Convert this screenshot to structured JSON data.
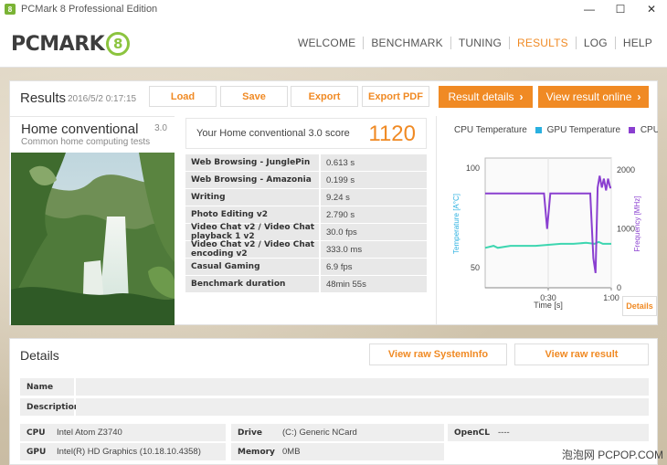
{
  "window": {
    "title": "PCMark 8 Professional Edition",
    "icon_glyph": "8",
    "controls": [
      "—",
      "☐",
      "✕"
    ]
  },
  "logo": {
    "text": "PCMARK",
    "badge": "8"
  },
  "nav": {
    "items": [
      "WELCOME",
      "BENCHMARK",
      "TUNING",
      "RESULTS",
      "LOG",
      "HELP"
    ],
    "active": "RESULTS"
  },
  "results": {
    "title": "Results",
    "date": "2016/5/2 0:17:15",
    "buttons": {
      "load": "Load",
      "save": "Save",
      "export": "Export",
      "export_pdf": "Export PDF",
      "result_details": "Result details",
      "view_online": "View result online"
    },
    "test": {
      "name": "Home conventional",
      "version": "3.0",
      "description": "Common home computing tests"
    },
    "score": {
      "label": "Your Home conventional 3.0 score",
      "value": "1120"
    },
    "rows": [
      {
        "label": "Web Browsing - JunglePin",
        "value": "0.613 s"
      },
      {
        "label": "Web Browsing - Amazonia",
        "value": "0.199 s"
      },
      {
        "label": "Writing",
        "value": "9.24 s"
      },
      {
        "label": "Photo Editing v2",
        "value": "2.790 s"
      },
      {
        "label": "Video Chat v2 / Video Chat playback 1 v2",
        "value": "30.0 fps"
      },
      {
        "label": "Video Chat v2 / Video Chat encoding v2",
        "value": "333.0 ms"
      },
      {
        "label": "Casual Gaming",
        "value": "6.9 fps"
      },
      {
        "label": "Benchmark duration",
        "value": "48min 55s"
      }
    ]
  },
  "chart_data": {
    "type": "line",
    "legend": [
      {
        "name": "CPU Temperature",
        "color": "#ffffff"
      },
      {
        "name": "GPU Temperature",
        "color": "#2ab0e0"
      },
      {
        "name": "CPU Clock Frequency",
        "color": "#8a3fd0"
      }
    ],
    "ylabel_left": "Temperature [A°C]",
    "ylabel_right": "Frequency [MHz]",
    "xlabel": "Time [s]",
    "y_left_ticks": [
      "100",
      "50"
    ],
    "y_right_ticks": [
      "2000",
      "1000",
      "0"
    ],
    "x_ticks": [
      "0:30",
      "1:00"
    ],
    "y_left_range": [
      40,
      105
    ],
    "y_right_range": [
      0,
      2200
    ],
    "x_range": [
      0,
      60
    ],
    "series": [
      {
        "name": "GPU Temperature",
        "axis": "left",
        "color": "#3dd6b0",
        "points": [
          [
            0,
            60
          ],
          [
            4,
            61
          ],
          [
            6,
            60
          ],
          [
            12,
            61
          ],
          [
            18,
            61
          ],
          [
            24,
            61
          ],
          [
            30,
            61.5
          ],
          [
            36,
            62
          ],
          [
            42,
            62
          ],
          [
            48,
            62.5
          ],
          [
            52,
            62
          ],
          [
            54,
            63
          ],
          [
            56,
            62
          ],
          [
            58,
            62
          ],
          [
            60,
            62
          ]
        ]
      },
      {
        "name": "CPU Clock Frequency",
        "axis": "right",
        "color": "#8a3fd0",
        "points": [
          [
            0,
            1600
          ],
          [
            27,
            1600
          ],
          [
            28,
            1600
          ],
          [
            29.5,
            1000
          ],
          [
            31,
            1600
          ],
          [
            50,
            1600
          ],
          [
            51.5,
            500
          ],
          [
            52.5,
            250
          ],
          [
            53.5,
            1700
          ],
          [
            54.5,
            1900
          ],
          [
            55.5,
            1700
          ],
          [
            56.5,
            1850
          ],
          [
            57.5,
            1650
          ],
          [
            58.5,
            1850
          ],
          [
            59.5,
            1700
          ],
          [
            60,
            1700
          ]
        ]
      }
    ],
    "details_button": "Details"
  },
  "details": {
    "title": "Details",
    "buttons": {
      "raw_sysinfo": "View raw SystemInfo",
      "raw_result": "View raw result"
    },
    "fields": {
      "name_label": "Name",
      "description_label": "Description",
      "cpu_label": "CPU",
      "cpu_value": "Intel Atom Z3740",
      "gpu_label": "GPU",
      "gpu_value": "Intel(R) HD Graphics (10.18.10.4358)",
      "drive_label": "Drive",
      "drive_value": "(C:) Generic NCard",
      "memory_label": "Memory",
      "memory_value": "0MB",
      "opencl_label": "OpenCL",
      "opencl_value": "----"
    }
  },
  "watermark": "泡泡网 PCPOP.COM"
}
